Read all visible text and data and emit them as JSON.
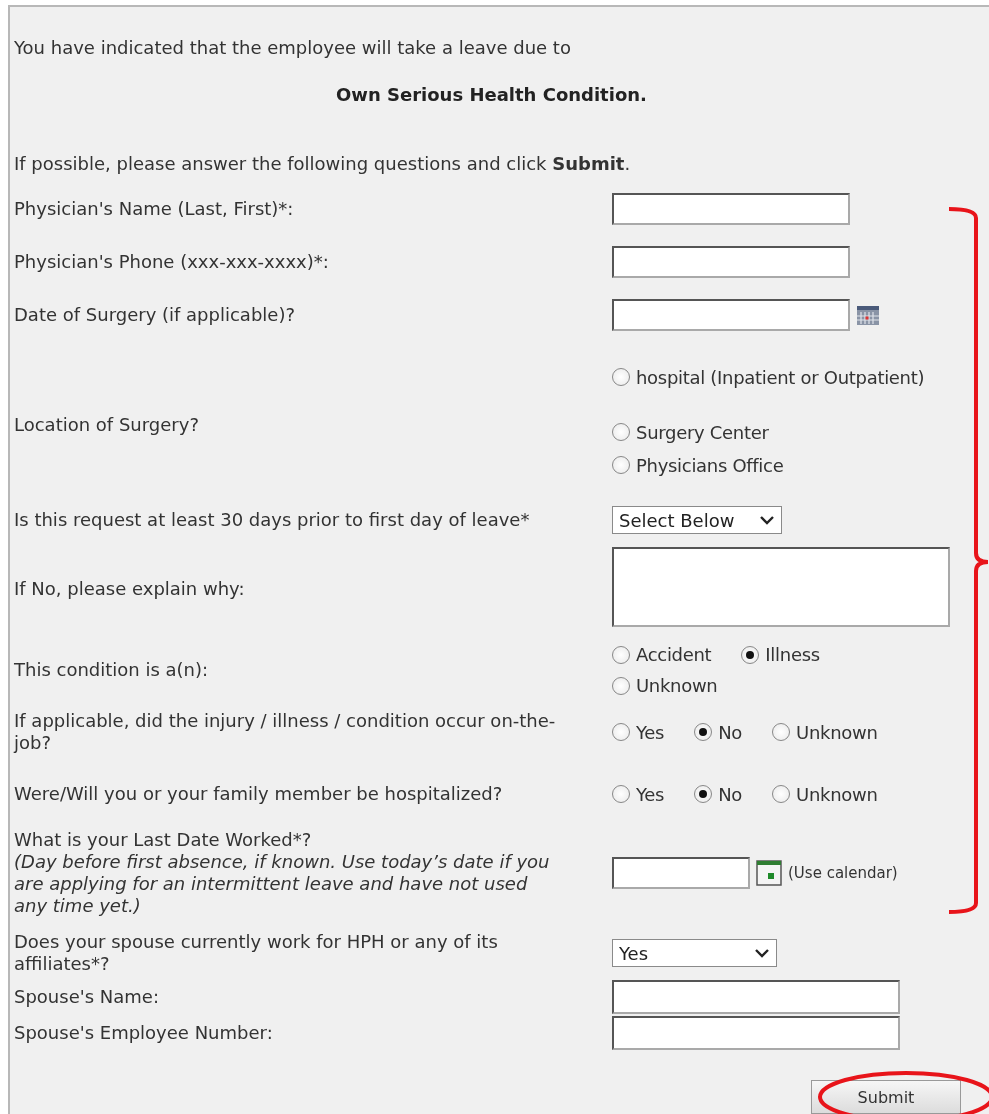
{
  "intro": "You have indicated that the employee will take a leave due to",
  "leave_reason": "Own Serious Health Condition.",
  "instruction": "If possible, please answer the following questions and click **Submit**.",
  "questions": [
    {
      "kind": "text",
      "label": "Physician's Name (Last, First)*:"
    },
    {
      "kind": "text",
      "label": "Physician's Phone (xxx-xxx-xxxx)*:"
    },
    {
      "kind": "date",
      "label": "Date of Surgery (if applicable)?"
    },
    {
      "kind": "radio-list",
      "label": "Location of Surgery?",
      "options": [
        {
          "label": "hospital (Inpatient or Outpatient)",
          "selected": false
        },
        {
          "label": "Surgery Center",
          "selected": false
        },
        {
          "label": "Physicians Office",
          "selected": false
        }
      ]
    },
    {
      "kind": "select",
      "label": "Is this request at least 30 days prior to first day of leave*",
      "value": "Select Below"
    },
    {
      "kind": "textarea",
      "label": "If No, please explain why:"
    },
    {
      "kind": "radio-inline",
      "label": "This condition is a(n):",
      "options": [
        {
          "label": "Accident",
          "selected": false
        },
        {
          "label": "Illness",
          "selected": true
        },
        {
          "label": "Unknown",
          "selected": false
        }
      ]
    },
    {
      "kind": "radio-inline",
      "label": "If applicable, did the injury / illness / condition occur on-the-job?",
      "options": [
        {
          "label": "Yes",
          "selected": false
        },
        {
          "label": "No",
          "selected": true
        },
        {
          "label": "Unknown",
          "selected": false
        }
      ]
    },
    {
      "kind": "radio-inline",
      "label": "Were/Will you or your family member be hospitalized?",
      "options": [
        {
          "label": "Yes",
          "selected": false
        },
        {
          "label": "No",
          "selected": true
        },
        {
          "label": "Unknown",
          "selected": false
        }
      ]
    },
    {
      "kind": "date-hint",
      "label": "What is your Last Date Worked*?",
      "note": "(Day before first absence, if known. Use today’s date if you are applying for an intermittent leave and have not used any time yet.)",
      "hint": "(Use calendar)"
    }
  ],
  "spouse_questions": [
    {
      "kind": "select",
      "label": "Does your spouse currently work for HPH or any of its affiliates*?",
      "value": "Yes"
    },
    {
      "kind": "text",
      "label": "Spouse's Name:"
    },
    {
      "kind": "text",
      "label": "Spouse's Employee Number:"
    }
  ],
  "submit": "Submit"
}
